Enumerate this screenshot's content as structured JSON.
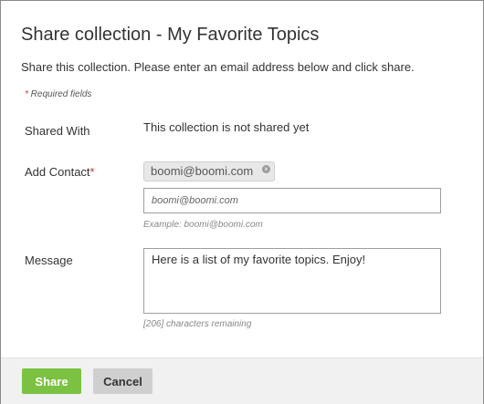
{
  "dialog": {
    "title": "Share collection - My Favorite Topics",
    "description": "Share this collection. Please enter an email address below and click share.",
    "required_star": "*",
    "required_text": " Required fields"
  },
  "shared_with": {
    "label": "Shared With",
    "value": "This collection is not shared yet"
  },
  "add_contact": {
    "label": "Add Contact",
    "required_star": "*",
    "chip_email": "boomi@boomi.com",
    "chip_close": "×",
    "input_placeholder": "boomi@boomi.com",
    "input_value": "",
    "example_hint": "Example: boomi@boomi.com"
  },
  "message": {
    "label": "Message",
    "value": "Here is a list of my favorite topics. Enjoy!",
    "remaining_hint": "[206] characters remaining"
  },
  "footer": {
    "share_label": "Share",
    "cancel_label": "Cancel"
  },
  "colors": {
    "share_button": "#7cc242",
    "cancel_button": "#cfcfcf",
    "required_star": "#c0392b"
  }
}
